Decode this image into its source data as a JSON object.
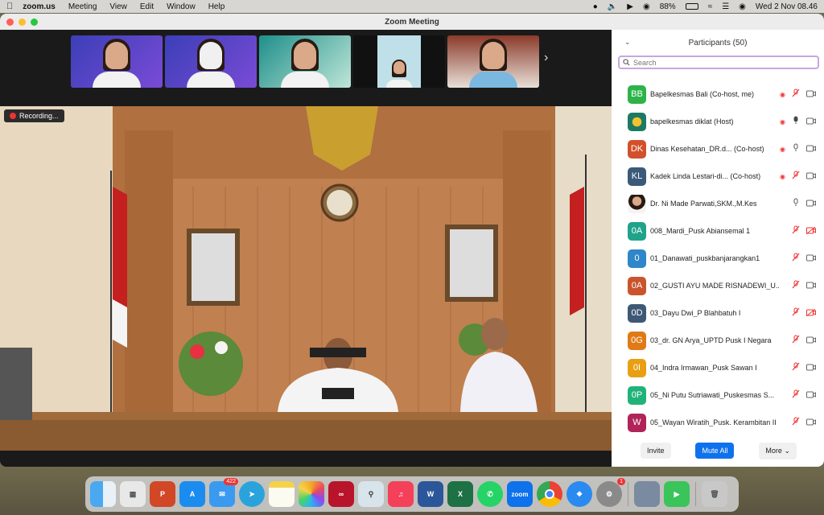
{
  "menubar": {
    "app": "zoom.us",
    "items": [
      "Meeting",
      "View",
      "Edit",
      "Window",
      "Help"
    ],
    "battery": "88%",
    "datetime": "Wed 2 Nov  08.46"
  },
  "window": {
    "title": "Zoom Meeting"
  },
  "recording_label": "Recording...",
  "participants": {
    "header": "Participants (50)",
    "search_placeholder": "Search",
    "list": [
      {
        "initials": "BB",
        "name": "Bapelkesmas Bali (Co-host, me)",
        "color": "#2db34a",
        "mic": "muted",
        "video": "off"
      },
      {
        "initials": "",
        "name": "bapelkesmas diklat (Host)",
        "color": "#1d7a62",
        "mic": "on",
        "video": "off"
      },
      {
        "initials": "DK",
        "name": "Dinas Kesehatan_DR.d... (Co-host)",
        "color": "#d2502b",
        "mic": "on",
        "video": "off"
      },
      {
        "initials": "KL",
        "name": "Kadek Linda Lestari-di... (Co-host)",
        "color": "#3b5a7a",
        "mic": "muted",
        "video": "off"
      },
      {
        "initials": "",
        "name": "Dr. Ni Made Parwati,SKM.,M.Kes",
        "color": "#b84a4a",
        "mic": "on",
        "video": "off"
      },
      {
        "initials": "0A",
        "name": "008_Mardi_Pusk Abiansemal 1",
        "color": "#1fa38a",
        "mic": "muted",
        "video": "muted"
      },
      {
        "initials": "0",
        "name": "01_Danawati_puskbanjarangkan1",
        "color": "#2f86c9",
        "mic": "muted",
        "video": "off"
      },
      {
        "initials": "0A",
        "name": "02_GUSTI AYU MADE RISNADEWI_U...",
        "color": "#c9542e",
        "mic": "muted",
        "video": "off"
      },
      {
        "initials": "0D",
        "name": "03_Dayu Dwi_P Blahbatuh I",
        "color": "#3e5875",
        "mic": "muted",
        "video": "muted"
      },
      {
        "initials": "0G",
        "name": "03_dr. GN Arya_UPTD Pusk I Negara",
        "color": "#e07a16",
        "mic": "muted",
        "video": "off"
      },
      {
        "initials": "0I",
        "name": "04_Indra Irmawan_Pusk Sawan I",
        "color": "#e8a012",
        "mic": "muted",
        "video": "off"
      },
      {
        "initials": "0P",
        "name": "05_Ni Putu Sutriawati_Puskesmas S...",
        "color": "#21b27a",
        "mic": "muted",
        "video": "off"
      },
      {
        "initials": "W",
        "name": "05_Wayan Wiratih_Pusk. Kerambitan II",
        "color": "#b0245a",
        "mic": "muted",
        "video": "off"
      }
    ],
    "invite_label": "Invite",
    "mute_all_label": "Mute All",
    "more_label": "More"
  },
  "dock": {
    "mail_badge": "422",
    "settings_badge": "1",
    "zoom_label": "zoom",
    "word_label": "W",
    "excel_label": "X"
  }
}
